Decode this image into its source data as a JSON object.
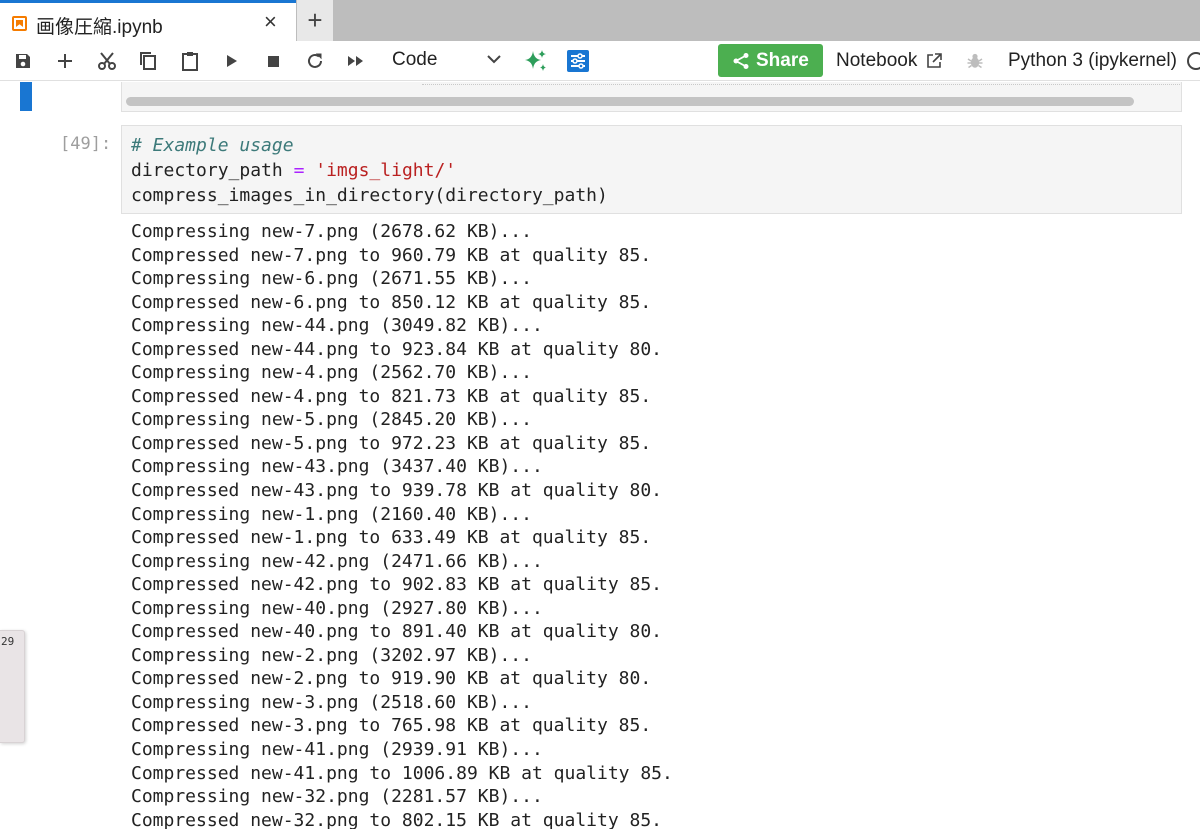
{
  "tab": {
    "title": "画像圧縮.ipynb",
    "close": "×",
    "add": "+"
  },
  "toolbar": {
    "cell_type": "Code",
    "share_label": "Share",
    "notebook_label": "Notebook",
    "kernel": "Python 3 (ipykernel)"
  },
  "cell": {
    "prompt": "[49]:",
    "comment": "# Example usage",
    "line2_var": "directory_path ",
    "line2_op": "=",
    "line2_str": "'imgs_light/'",
    "line3": "compress_images_in_directory(directory_path)"
  },
  "output": {
    "lines": [
      "Compressing new-7.png (2678.62 KB)...",
      "Compressed new-7.png to 960.79 KB at quality 85.",
      "Compressing new-6.png (2671.55 KB)...",
      "Compressed new-6.png to 850.12 KB at quality 85.",
      "Compressing new-44.png (3049.82 KB)...",
      "Compressed new-44.png to 923.84 KB at quality 80.",
      "Compressing new-4.png (2562.70 KB)...",
      "Compressed new-4.png to 821.73 KB at quality 85.",
      "Compressing new-5.png (2845.20 KB)...",
      "Compressed new-5.png to 972.23 KB at quality 85.",
      "Compressing new-43.png (3437.40 KB)...",
      "Compressed new-43.png to 939.78 KB at quality 80.",
      "Compressing new-1.png (2160.40 KB)...",
      "Compressed new-1.png to 633.49 KB at quality 85.",
      "Compressing new-42.png (2471.66 KB)...",
      "Compressed new-42.png to 902.83 KB at quality 85.",
      "Compressing new-40.png (2927.80 KB)...",
      "Compressed new-40.png to 891.40 KB at quality 80.",
      "Compressing new-2.png (3202.97 KB)...",
      "Compressed new-2.png to 919.90 KB at quality 80.",
      "Compressing new-3.png (2518.60 KB)...",
      "Compressed new-3.png to 765.98 KB at quality 85.",
      "Compressing new-41.png (2939.91 KB)...",
      "Compressed new-41.png to 1006.89 KB at quality 85.",
      "Compressing new-32.png (2281.57 KB)...",
      "Compressed new-32.png to 802.15 KB at quality 85."
    ]
  },
  "side_panel": {
    "text": "29"
  },
  "colors": {
    "accent": "#1976d2",
    "share": "#4caf50",
    "jupyter_orange": "#f57c00"
  }
}
